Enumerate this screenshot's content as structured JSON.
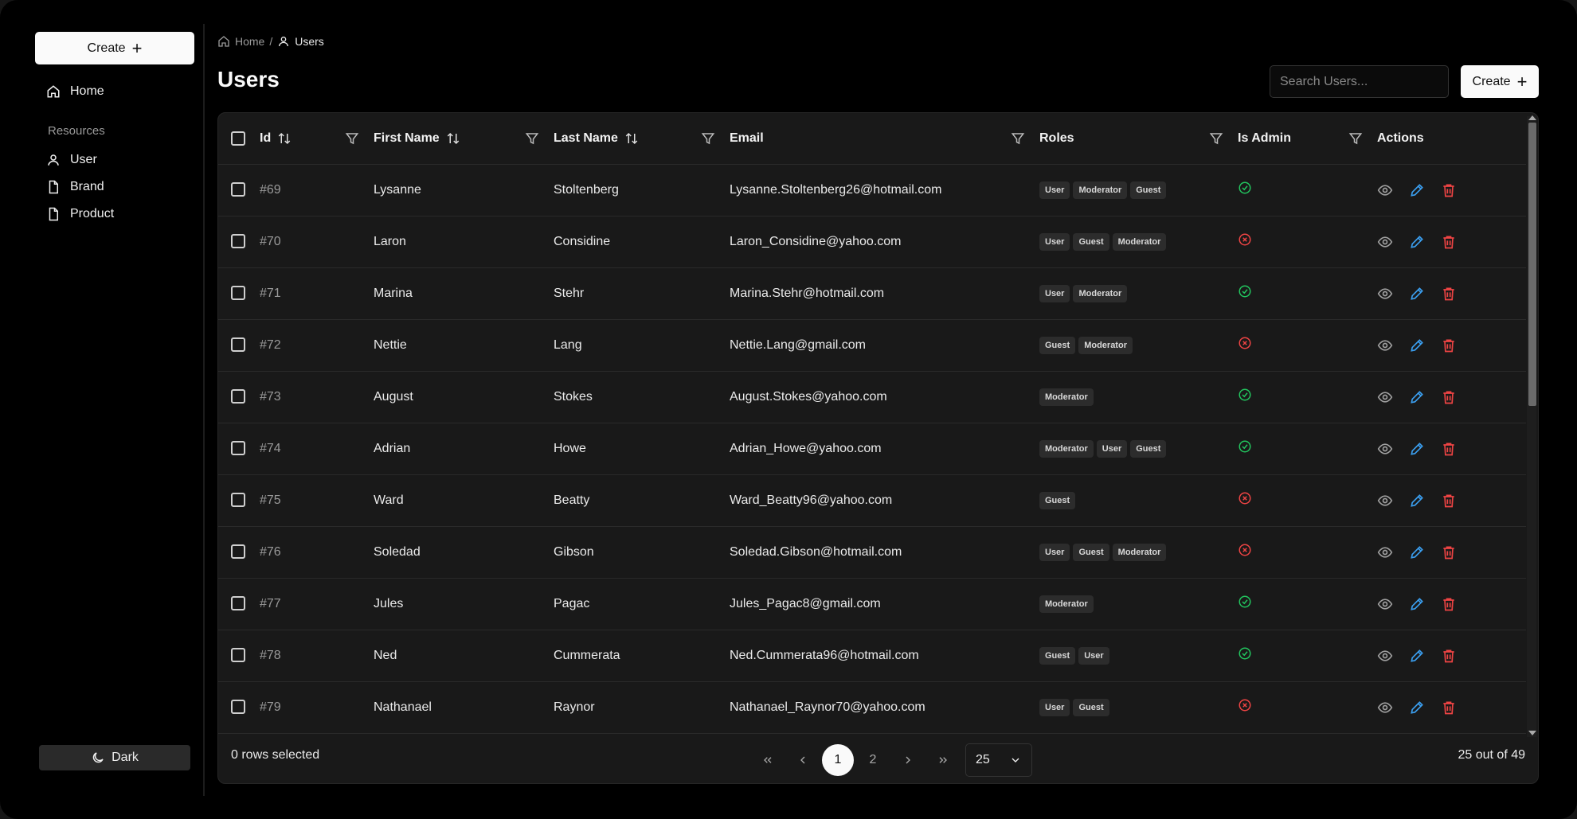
{
  "sidebar": {
    "create_label": "Create",
    "home_label": "Home",
    "section_label": "Resources",
    "items": [
      {
        "label": "User",
        "icon": "user-icon"
      },
      {
        "label": "Brand",
        "icon": "file-icon"
      },
      {
        "label": "Product",
        "icon": "file-icon"
      }
    ],
    "theme_label": "Dark"
  },
  "breadcrumb": {
    "home": "Home",
    "separator": "/",
    "current": "Users"
  },
  "header": {
    "title": "Users",
    "search_placeholder": "Search Users...",
    "create_label": "Create"
  },
  "table": {
    "columns": {
      "id": "Id",
      "first_name": "First Name",
      "last_name": "Last Name",
      "email": "Email",
      "roles": "Roles",
      "is_admin": "Is Admin",
      "actions": "Actions"
    },
    "rows": [
      {
        "id": "#69",
        "first": "Lysanne",
        "last": "Stoltenberg",
        "email": "Lysanne.Stoltenberg26@hotmail.com",
        "roles": [
          "User",
          "Moderator",
          "Guest"
        ],
        "admin": true
      },
      {
        "id": "#70",
        "first": "Laron",
        "last": "Considine",
        "email": "Laron_Considine@yahoo.com",
        "roles": [
          "User",
          "Guest",
          "Moderator"
        ],
        "admin": false
      },
      {
        "id": "#71",
        "first": "Marina",
        "last": "Stehr",
        "email": "Marina.Stehr@hotmail.com",
        "roles": [
          "User",
          "Moderator"
        ],
        "admin": true
      },
      {
        "id": "#72",
        "first": "Nettie",
        "last": "Lang",
        "email": "Nettie.Lang@gmail.com",
        "roles": [
          "Guest",
          "Moderator"
        ],
        "admin": false
      },
      {
        "id": "#73",
        "first": "August",
        "last": "Stokes",
        "email": "August.Stokes@yahoo.com",
        "roles": [
          "Moderator"
        ],
        "admin": true
      },
      {
        "id": "#74",
        "first": "Adrian",
        "last": "Howe",
        "email": "Adrian_Howe@yahoo.com",
        "roles": [
          "Moderator",
          "User",
          "Guest"
        ],
        "admin": true
      },
      {
        "id": "#75",
        "first": "Ward",
        "last": "Beatty",
        "email": "Ward_Beatty96@yahoo.com",
        "roles": [
          "Guest"
        ],
        "admin": false
      },
      {
        "id": "#76",
        "first": "Soledad",
        "last": "Gibson",
        "email": "Soledad.Gibson@hotmail.com",
        "roles": [
          "User",
          "Guest",
          "Moderator"
        ],
        "admin": false
      },
      {
        "id": "#77",
        "first": "Jules",
        "last": "Pagac",
        "email": "Jules_Pagac8@gmail.com",
        "roles": [
          "Moderator"
        ],
        "admin": true
      },
      {
        "id": "#78",
        "first": "Ned",
        "last": "Cummerata",
        "email": "Ned.Cummerata96@hotmail.com",
        "roles": [
          "Guest",
          "User"
        ],
        "admin": true
      },
      {
        "id": "#79",
        "first": "Nathanael",
        "last": "Raynor",
        "email": "Nathanael_Raynor70@yahoo.com",
        "roles": [
          "User",
          "Guest"
        ],
        "admin": false
      }
    ]
  },
  "footer": {
    "selected_text": "0 rows selected",
    "pages": [
      "1",
      "2"
    ],
    "current_page": "1",
    "page_size": "25",
    "summary": "25 out of 49"
  },
  "colors": {
    "admin_true": "#22c55e",
    "admin_false": "#ef4444",
    "edit": "#3b9ff0",
    "delete": "#ef4444",
    "view": "#a0a0a0"
  }
}
